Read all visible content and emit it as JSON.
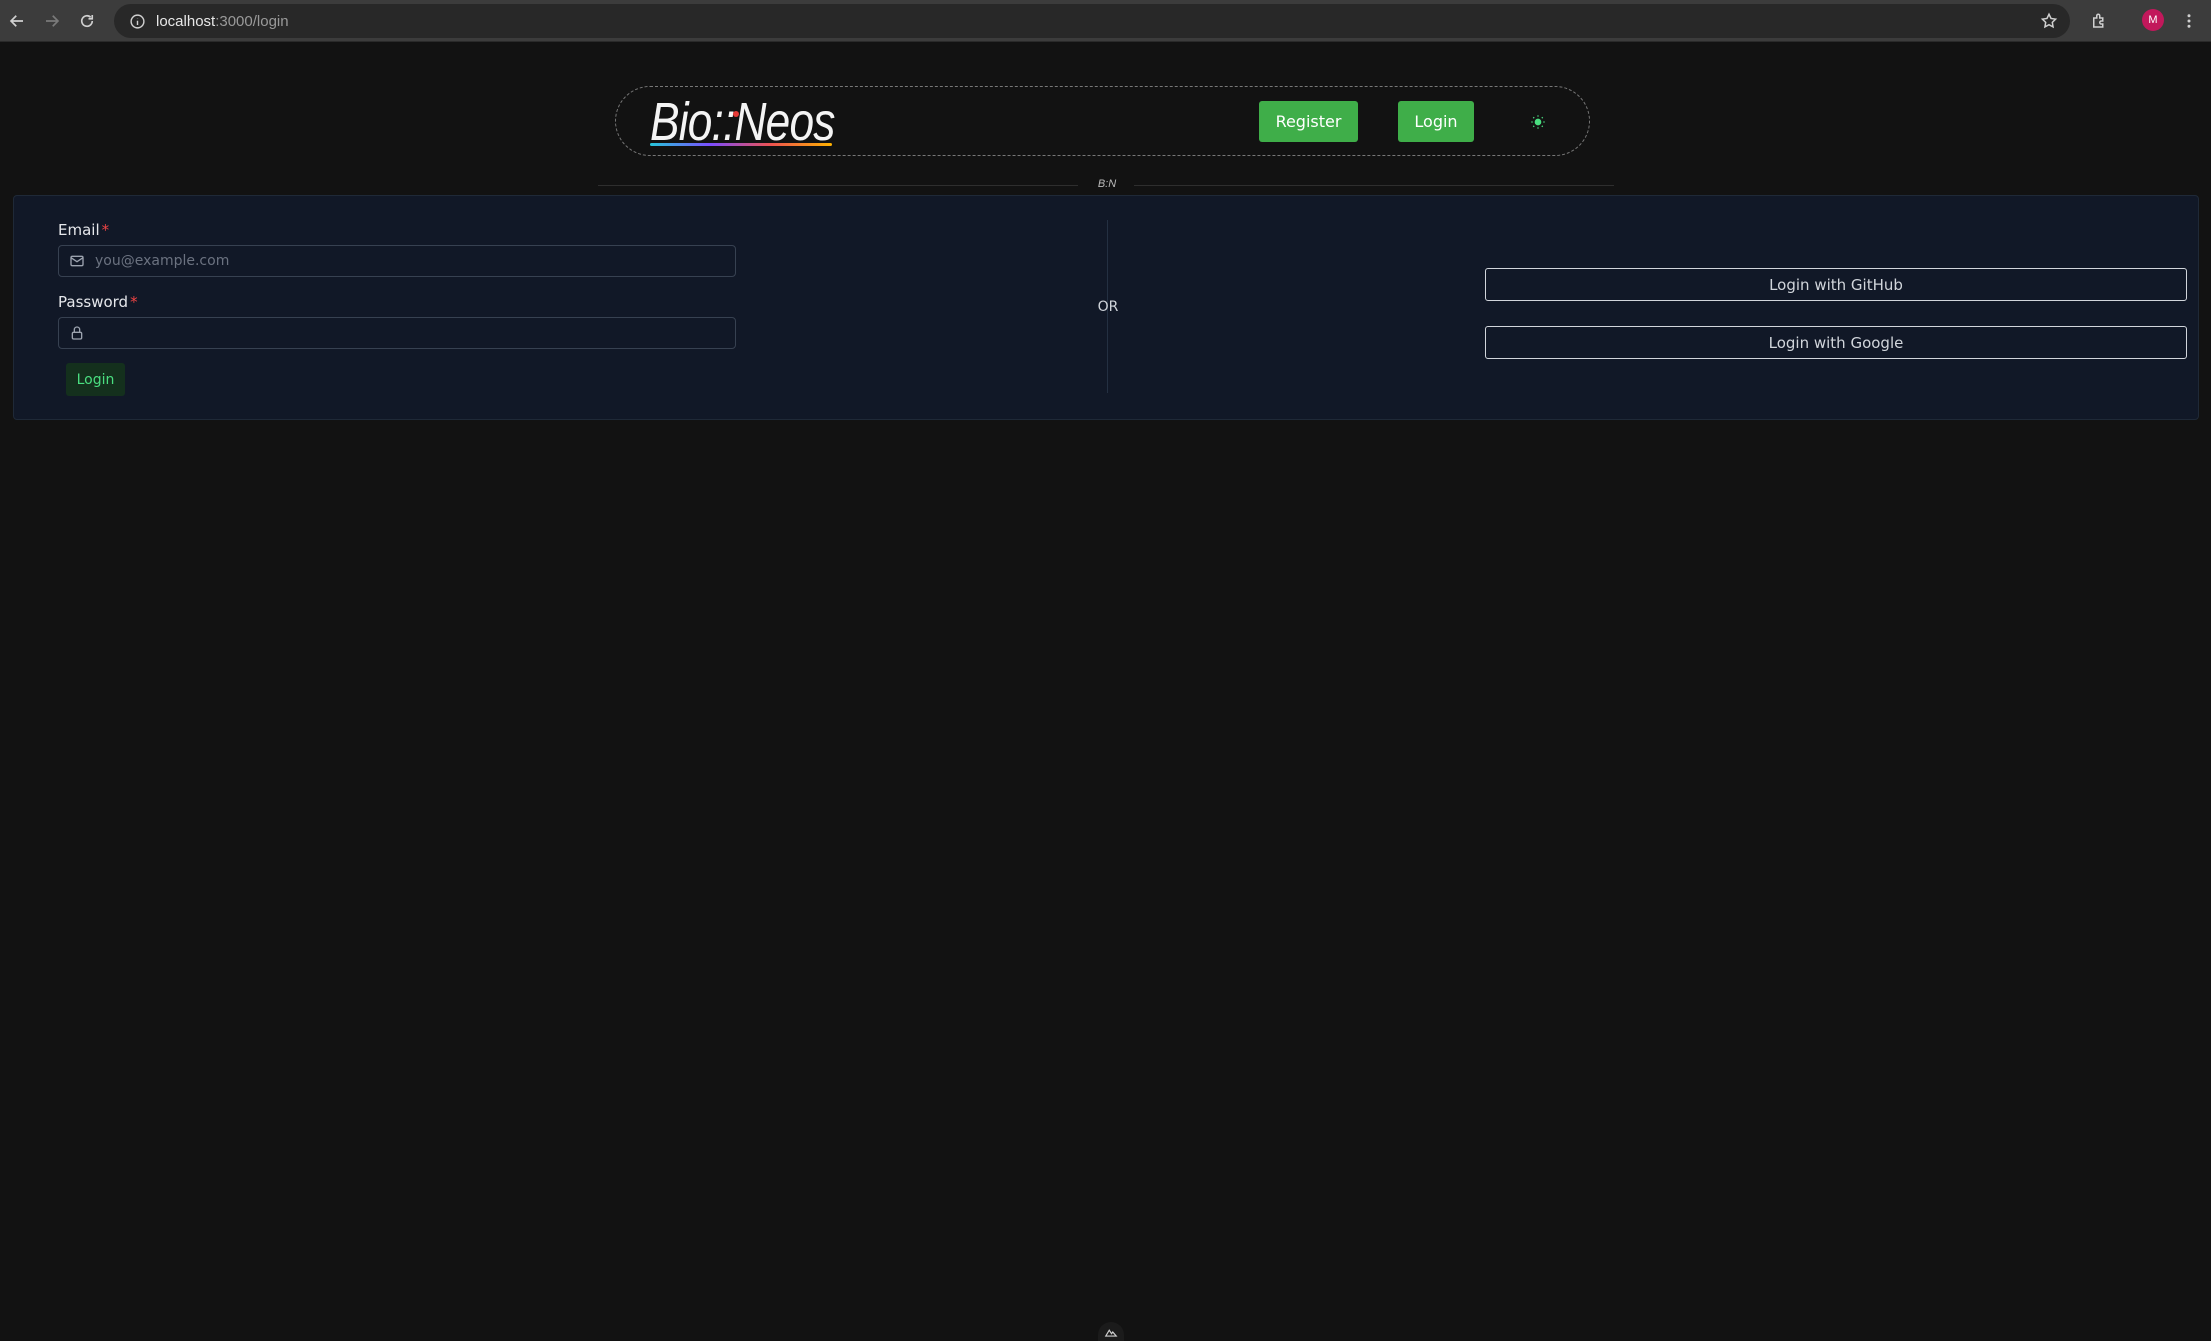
{
  "browser": {
    "url_host": "localhost",
    "url_path": ":3000/login",
    "profile_initial": "M"
  },
  "header": {
    "logo_text": "Bio::Neos",
    "register_label": "Register",
    "login_label": "Login"
  },
  "divider": {
    "mark_text": "B:N"
  },
  "form": {
    "email_label": "Email",
    "email_required": "*",
    "email_placeholder": "you@example.com",
    "password_label": "Password",
    "password_required": "*",
    "submit_label": "Login"
  },
  "separator": {
    "or_text": "OR"
  },
  "oauth": {
    "github_label": "Login with GitHub",
    "google_label": "Login with Google"
  },
  "colors": {
    "page_bg": "#121212",
    "card_bg": "#111827",
    "accent_green": "#3fae49",
    "required_red": "#ef4444"
  }
}
